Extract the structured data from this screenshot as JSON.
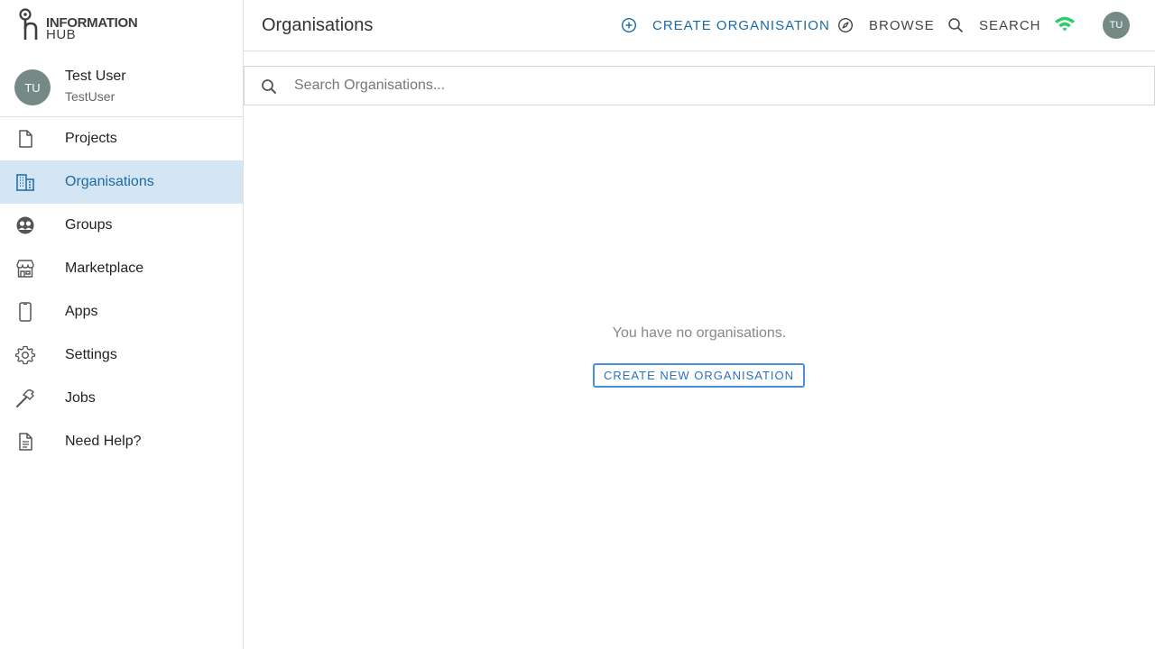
{
  "brand": {
    "line1": "INFORMATION",
    "line2": "HUB"
  },
  "user": {
    "initials": "TU",
    "name": "Test User",
    "handle": "TestUser"
  },
  "nav": {
    "items": [
      {
        "label": "Projects",
        "icon": "file-icon"
      },
      {
        "label": "Organisations",
        "icon": "building-icon",
        "active": true
      },
      {
        "label": "Groups",
        "icon": "groups-icon"
      },
      {
        "label": "Marketplace",
        "icon": "store-icon"
      },
      {
        "label": "Apps",
        "icon": "phone-icon"
      },
      {
        "label": "Settings",
        "icon": "gear-icon"
      },
      {
        "label": "Jobs",
        "icon": "hammer-icon"
      },
      {
        "label": "Need Help?",
        "icon": "document-icon"
      }
    ]
  },
  "header": {
    "title": "Organisations",
    "create_label": "CREATE ORGANISATION",
    "browse_label": "BROWSE",
    "search_label": "SEARCH",
    "avatar_initials": "TU"
  },
  "search": {
    "placeholder": "Search Organisations..."
  },
  "empty": {
    "message": "You have no organisations.",
    "button_label": "CREATE NEW ORGANISATION"
  },
  "colors": {
    "accent": "#1a6aa6",
    "active_bg": "#d4e6f3",
    "connection_ok": "#2ecc71",
    "avatar": "#758a84"
  }
}
